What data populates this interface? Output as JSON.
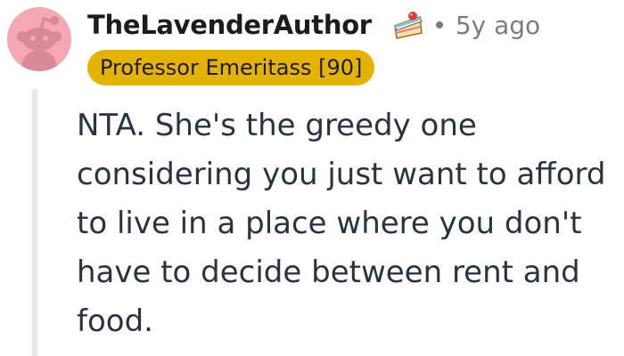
{
  "comment": {
    "username": "TheLavenderAuthor",
    "award_icon": "cake-slice-icon",
    "timestamp": "5y ago",
    "flair": "Professor Emeritass [90]",
    "body": "NTA. She's the greedy one considering you just want to afford to live in a place where you don't have to decide between rent and food."
  },
  "colors": {
    "avatar_background": "#f6a7b1",
    "flair_background": "#e4b300",
    "meta_text": "#7c7c7c",
    "body_text": "#2a3441",
    "thread_line": "#e7e7e7"
  }
}
